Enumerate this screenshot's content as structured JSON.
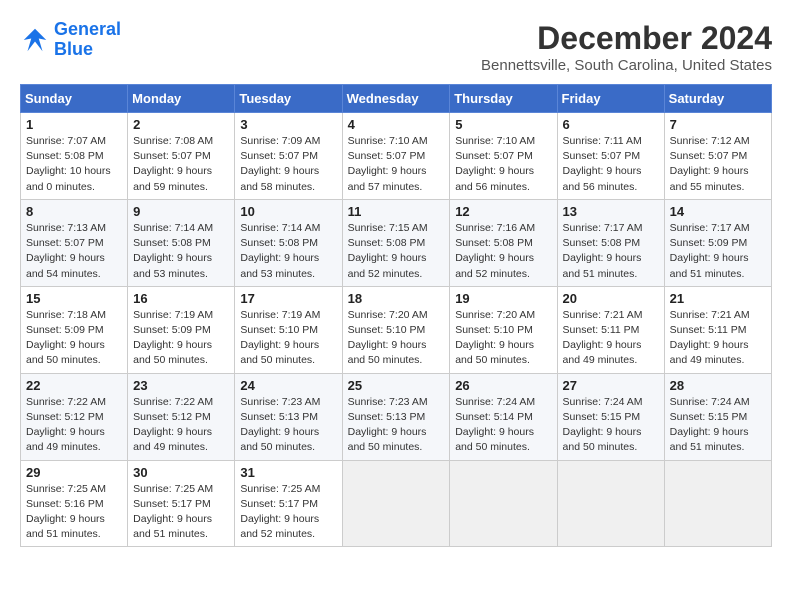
{
  "logo": {
    "line1": "General",
    "line2": "Blue"
  },
  "title": "December 2024",
  "location": "Bennettsville, South Carolina, United States",
  "days_of_week": [
    "Sunday",
    "Monday",
    "Tuesday",
    "Wednesday",
    "Thursday",
    "Friday",
    "Saturday"
  ],
  "weeks": [
    [
      {
        "day": "1",
        "rise": "7:07 AM",
        "set": "5:08 PM",
        "daylight": "10 hours and 0 minutes."
      },
      {
        "day": "2",
        "rise": "7:08 AM",
        "set": "5:07 PM",
        "daylight": "9 hours and 59 minutes."
      },
      {
        "day": "3",
        "rise": "7:09 AM",
        "set": "5:07 PM",
        "daylight": "9 hours and 58 minutes."
      },
      {
        "day": "4",
        "rise": "7:10 AM",
        "set": "5:07 PM",
        "daylight": "9 hours and 57 minutes."
      },
      {
        "day": "5",
        "rise": "7:10 AM",
        "set": "5:07 PM",
        "daylight": "9 hours and 56 minutes."
      },
      {
        "day": "6",
        "rise": "7:11 AM",
        "set": "5:07 PM",
        "daylight": "9 hours and 56 minutes."
      },
      {
        "day": "7",
        "rise": "7:12 AM",
        "set": "5:07 PM",
        "daylight": "9 hours and 55 minutes."
      }
    ],
    [
      {
        "day": "8",
        "rise": "7:13 AM",
        "set": "5:07 PM",
        "daylight": "9 hours and 54 minutes."
      },
      {
        "day": "9",
        "rise": "7:14 AM",
        "set": "5:08 PM",
        "daylight": "9 hours and 53 minutes."
      },
      {
        "day": "10",
        "rise": "7:14 AM",
        "set": "5:08 PM",
        "daylight": "9 hours and 53 minutes."
      },
      {
        "day": "11",
        "rise": "7:15 AM",
        "set": "5:08 PM",
        "daylight": "9 hours and 52 minutes."
      },
      {
        "day": "12",
        "rise": "7:16 AM",
        "set": "5:08 PM",
        "daylight": "9 hours and 52 minutes."
      },
      {
        "day": "13",
        "rise": "7:17 AM",
        "set": "5:08 PM",
        "daylight": "9 hours and 51 minutes."
      },
      {
        "day": "14",
        "rise": "7:17 AM",
        "set": "5:09 PM",
        "daylight": "9 hours and 51 minutes."
      }
    ],
    [
      {
        "day": "15",
        "rise": "7:18 AM",
        "set": "5:09 PM",
        "daylight": "9 hours and 50 minutes."
      },
      {
        "day": "16",
        "rise": "7:19 AM",
        "set": "5:09 PM",
        "daylight": "9 hours and 50 minutes."
      },
      {
        "day": "17",
        "rise": "7:19 AM",
        "set": "5:10 PM",
        "daylight": "9 hours and 50 minutes."
      },
      {
        "day": "18",
        "rise": "7:20 AM",
        "set": "5:10 PM",
        "daylight": "9 hours and 50 minutes."
      },
      {
        "day": "19",
        "rise": "7:20 AM",
        "set": "5:10 PM",
        "daylight": "9 hours and 50 minutes."
      },
      {
        "day": "20",
        "rise": "7:21 AM",
        "set": "5:11 PM",
        "daylight": "9 hours and 49 minutes."
      },
      {
        "day": "21",
        "rise": "7:21 AM",
        "set": "5:11 PM",
        "daylight": "9 hours and 49 minutes."
      }
    ],
    [
      {
        "day": "22",
        "rise": "7:22 AM",
        "set": "5:12 PM",
        "daylight": "9 hours and 49 minutes."
      },
      {
        "day": "23",
        "rise": "7:22 AM",
        "set": "5:12 PM",
        "daylight": "9 hours and 49 minutes."
      },
      {
        "day": "24",
        "rise": "7:23 AM",
        "set": "5:13 PM",
        "daylight": "9 hours and 50 minutes."
      },
      {
        "day": "25",
        "rise": "7:23 AM",
        "set": "5:13 PM",
        "daylight": "9 hours and 50 minutes."
      },
      {
        "day": "26",
        "rise": "7:24 AM",
        "set": "5:14 PM",
        "daylight": "9 hours and 50 minutes."
      },
      {
        "day": "27",
        "rise": "7:24 AM",
        "set": "5:15 PM",
        "daylight": "9 hours and 50 minutes."
      },
      {
        "day": "28",
        "rise": "7:24 AM",
        "set": "5:15 PM",
        "daylight": "9 hours and 51 minutes."
      }
    ],
    [
      {
        "day": "29",
        "rise": "7:25 AM",
        "set": "5:16 PM",
        "daylight": "9 hours and 51 minutes."
      },
      {
        "day": "30",
        "rise": "7:25 AM",
        "set": "5:17 PM",
        "daylight": "9 hours and 51 minutes."
      },
      {
        "day": "31",
        "rise": "7:25 AM",
        "set": "5:17 PM",
        "daylight": "9 hours and 52 minutes."
      },
      null,
      null,
      null,
      null
    ]
  ]
}
